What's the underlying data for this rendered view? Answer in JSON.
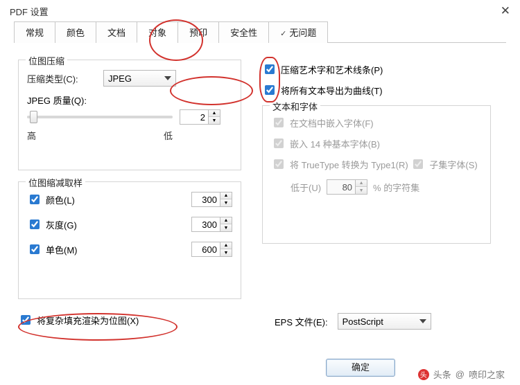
{
  "window": {
    "title": "PDF 设置",
    "close": "✕"
  },
  "tabs": [
    {
      "label": "常规"
    },
    {
      "label": "颜色"
    },
    {
      "label": "文档"
    },
    {
      "label": "对象",
      "active": true
    },
    {
      "label": "预印"
    },
    {
      "label": "安全性"
    },
    {
      "label": "无问题",
      "tick": true
    }
  ],
  "bitmap_compression": {
    "legend": "位图压缩",
    "type_label": "压缩类型(C):",
    "type_value": "JPEG",
    "quality_label": "JPEG 质量(Q):",
    "quality_value": "2",
    "high": "高",
    "low": "低"
  },
  "downsampling": {
    "legend": "位图缩减取样",
    "color_label": "颜色(L)",
    "color_value": "300",
    "gray_label": "灰度(G)",
    "gray_value": "300",
    "mono_label": "单色(M)",
    "mono_value": "600"
  },
  "render_complex": {
    "label": "将复杂填充渲染为位图(X)"
  },
  "right_checks": {
    "compress_art": "压缩艺术字和艺术线条(P)",
    "export_curves": "将所有文本导出为曲线(T)"
  },
  "text_fonts": {
    "legend": "文本和字体",
    "embed": "在文档中嵌入字体(F)",
    "embed14": "嵌入 14 种基本字体(B)",
    "tt_to_t1": "将 TrueType 转换为 Type1(R)",
    "subset": "子集字体(S)",
    "below_label": "低于(U)",
    "below_value": "80",
    "suffix": "% 的字符集"
  },
  "eps": {
    "label": "EPS 文件(E):",
    "value": "PostScript"
  },
  "buttons": {
    "ok": "确定"
  },
  "footer": {
    "brand_short": "头",
    "brand": "头条",
    "link": "喷印之家"
  }
}
